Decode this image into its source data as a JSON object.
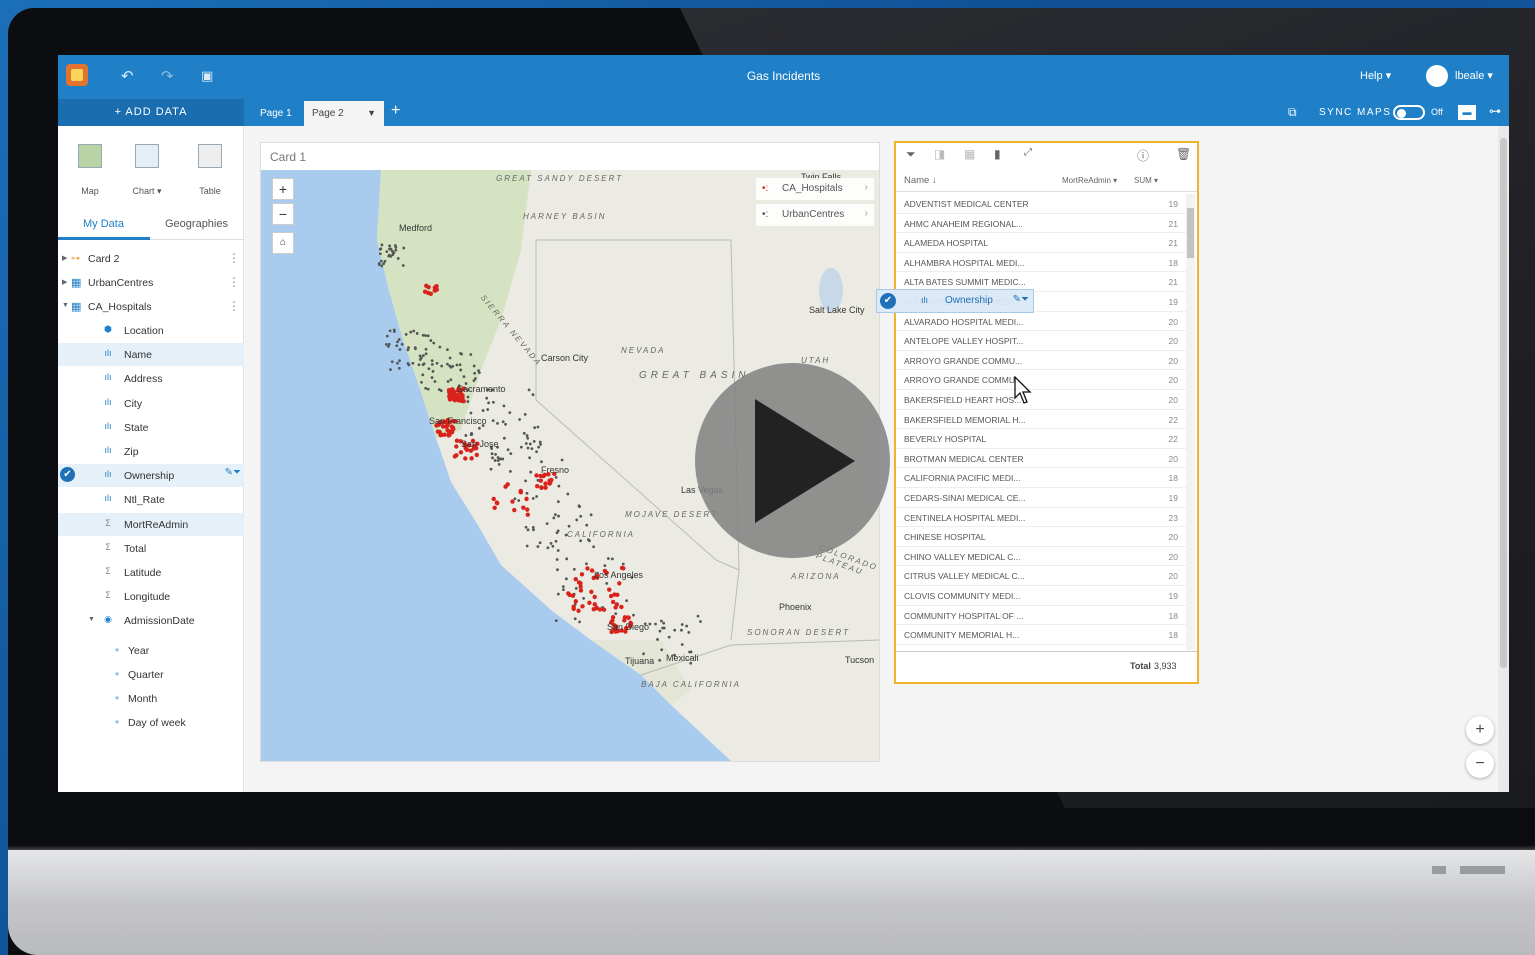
{
  "app": {
    "title": "Gas Incidents",
    "help_label": "Help ▾",
    "user_label": "lbeale ▾"
  },
  "toolbar": {
    "undo_icon": "undo-icon",
    "redo_icon": "redo-icon",
    "save_icon": "save-icon"
  },
  "tabs": {
    "add_data_label": "+ ADD DATA",
    "page1": "Page 1",
    "page2": "Page 2",
    "add_page": "+"
  },
  "sync": {
    "label": "SYNC MAPS",
    "state": "Off"
  },
  "viz_buttons": [
    "Map",
    "Chart ▾",
    "Table"
  ],
  "data_panel": {
    "tab_my_data": "My Data",
    "tab_geographies": "Geographies",
    "datasets": [
      "Card 2",
      "UrbanCentres",
      "CA_Hospitals"
    ],
    "fields": [
      {
        "icon": "location-icon",
        "glyph": "⬢",
        "label": "Location"
      },
      {
        "icon": "string-field-icon",
        "glyph": "ılı",
        "label": "Name",
        "highlighted": true
      },
      {
        "icon": "string-field-icon",
        "glyph": "ılı",
        "label": "Address"
      },
      {
        "icon": "string-field-icon",
        "glyph": "ılı",
        "label": "City"
      },
      {
        "icon": "string-field-icon",
        "glyph": "ılı",
        "label": "State"
      },
      {
        "icon": "string-field-icon",
        "glyph": "ılı",
        "label": "Zip"
      },
      {
        "icon": "string-field-icon",
        "glyph": "ılı",
        "label": "Ownership",
        "highlighted": true,
        "selected": true
      },
      {
        "icon": "string-field-icon",
        "glyph": "ılı",
        "label": "Ntl_Rate"
      },
      {
        "icon": "sum-icon",
        "glyph": "Σ",
        "label": "MortReAdmin",
        "highlighted": true
      },
      {
        "icon": "sum-icon",
        "glyph": "Σ",
        "label": "Total"
      },
      {
        "icon": "sum-icon",
        "glyph": "Σ",
        "label": "Latitude"
      },
      {
        "icon": "sum-icon",
        "glyph": "Σ",
        "label": "Longitude"
      },
      {
        "icon": "date-icon",
        "glyph": "◉",
        "label": "AdmissionDate"
      }
    ],
    "date_parts": [
      "Year",
      "Quarter",
      "Month",
      "Day of week"
    ]
  },
  "card1": {
    "title": "Card 1",
    "legend": [
      "CA_Hospitals",
      "UrbanCentres"
    ],
    "map_labels": [
      "GREAT SANDY DESERT",
      "HARNEY BASIN",
      "GREAT BASIN",
      "MOJAVE DESERT",
      "SONORAN DESERT",
      "NEVADA",
      "UTAH",
      "ARIZONA",
      "CALIFORNIA",
      "SIERRA NEVADA",
      "COLORADO PLATEAU",
      "BAJA CALIFORNIA"
    ],
    "city_labels": [
      "Sacramento",
      "San Francisco",
      "San Jose",
      "Fresno",
      "Los Angeles",
      "San Diego",
      "Tijuana",
      "Mexicali",
      "Phoenix",
      "Tucson",
      "Las Vegas",
      "Carson City",
      "Salt Lake City",
      "Medford",
      "Twin Falls"
    ]
  },
  "card2": {
    "col_name": "Name ↓",
    "col_value": "MortReAdmin ▾",
    "col_stat": "SUM ▾",
    "rows": [
      {
        "name": "ADVENTIST MEDICAL CENTER",
        "value": "19"
      },
      {
        "name": "AHMC ANAHEIM REGIONAL...",
        "value": "21"
      },
      {
        "name": "ALAMEDA HOSPITAL",
        "value": "21"
      },
      {
        "name": "ALHAMBRA HOSPITAL MEDI...",
        "value": "18"
      },
      {
        "name": "ALTA BATES SUMMIT MEDIC...",
        "value": "21"
      },
      {
        "name": "ALTA BATES SUMMIT MEDIC...",
        "value": "19"
      },
      {
        "name": "ALVARADO HOSPITAL MEDI...",
        "value": "20"
      },
      {
        "name": "ANTELOPE VALLEY HOSPIT...",
        "value": "20"
      },
      {
        "name": "ARROYO GRANDE COMMU...",
        "value": "20"
      },
      {
        "name": "ARROYO GRANDE COMMU...",
        "value": "20"
      },
      {
        "name": "BAKERSFIELD HEART HOS...",
        "value": "20"
      },
      {
        "name": "BAKERSFIELD MEMORIAL H...",
        "value": "22"
      },
      {
        "name": "BEVERLY HOSPITAL",
        "value": "22"
      },
      {
        "name": "BROTMAN MEDICAL CENTER",
        "value": "20"
      },
      {
        "name": "CALIFORNIA PACIFIC MEDI...",
        "value": "18"
      },
      {
        "name": "CEDARS-SINAI MEDICAL CE...",
        "value": "19"
      },
      {
        "name": "CENTINELA HOSPITAL MEDI...",
        "value": "23"
      },
      {
        "name": "CHINESE HOSPITAL",
        "value": "20"
      },
      {
        "name": "CHINO VALLEY MEDICAL C...",
        "value": "20"
      },
      {
        "name": "CITRUS VALLEY MEDICAL C...",
        "value": "20"
      },
      {
        "name": "CLOVIS COMMUNITY MEDI...",
        "value": "19"
      },
      {
        "name": "COMMUNITY HOSPITAL OF ...",
        "value": "18"
      },
      {
        "name": "COMMUNITY MEMORIAL H...",
        "value": "18"
      }
    ],
    "total_label": "Total",
    "total_value": "3,933"
  },
  "drag_chip": {
    "label": "Ownership"
  },
  "colors": {
    "accent": "#1f80c8",
    "selection": "#f0b42a",
    "hospital_points": "#d9221c",
    "urban_points": "#555555"
  }
}
